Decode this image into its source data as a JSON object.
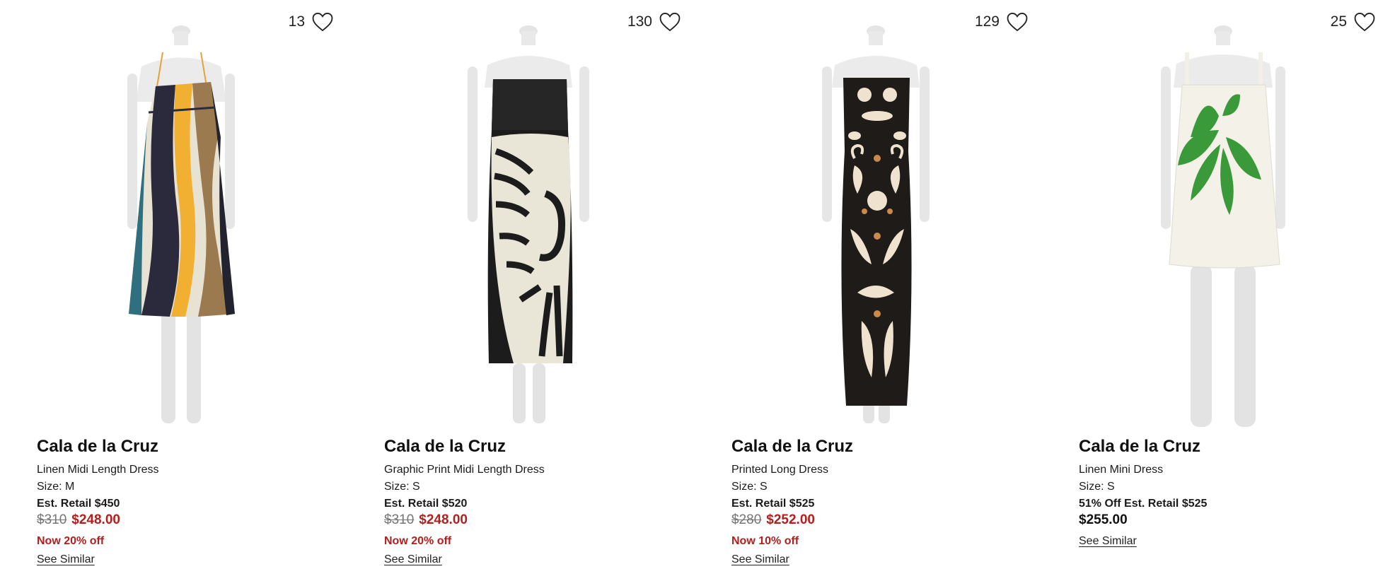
{
  "products": [
    {
      "favorites": "13",
      "brand": "Cala de la Cruz",
      "name": "Linen Midi Length Dress",
      "size": "Size: M",
      "retail": "Est. Retail $450",
      "original_price": "$310",
      "price": "$248.00",
      "discount": "Now 20% off",
      "see_similar": "See Similar",
      "image_icon": "dress-photo-colorblock-midi"
    },
    {
      "favorites": "130",
      "brand": "Cala de la Cruz",
      "name": "Graphic Print Midi Length Dress",
      "size": "Size: S",
      "retail": "Est. Retail $520",
      "original_price": "$310",
      "price": "$248.00",
      "discount": "Now 20% off",
      "see_similar": "See Similar",
      "image_icon": "dress-photo-sun-print-strapless"
    },
    {
      "favorites": "129",
      "brand": "Cala de la Cruz",
      "name": "Printed Long Dress",
      "size": "Size: S",
      "retail": "Est. Retail $525",
      "original_price": "$280",
      "price": "$252.00",
      "discount": "Now 10% off",
      "see_similar": "See Similar",
      "image_icon": "dress-photo-tribal-print-long"
    },
    {
      "favorites": "25",
      "brand": "Cala de la Cruz",
      "name": "Linen Mini Dress",
      "size": "Size: S",
      "retail_combined": "51% Off Est. Retail $525",
      "price": "$255.00",
      "see_similar": "See Similar",
      "image_icon": "dress-photo-leaf-print-mini"
    }
  ],
  "colors": {
    "sale_red": "#b11f1f",
    "strike_gray": "#757575"
  }
}
